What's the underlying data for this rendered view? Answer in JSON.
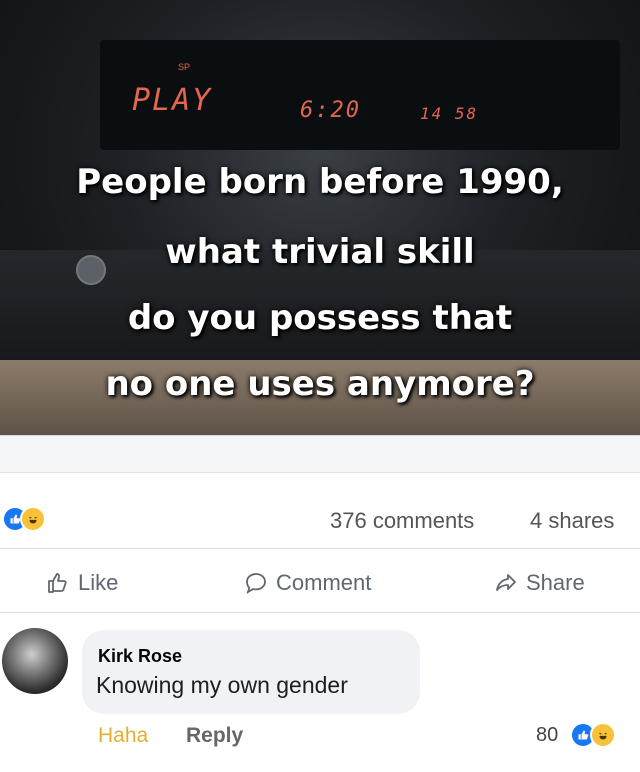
{
  "image": {
    "vcr_play": "PLAY",
    "vcr_sp": "SP",
    "vcr_time": "6:20",
    "vcr_counter": "14 58",
    "overlay_lines": [
      "People born before 1990,",
      "what trivial skill",
      "do you possess that",
      "no one uses anymore?"
    ]
  },
  "post_stats": {
    "reactions": [
      "like",
      "haha"
    ],
    "comments": "376 comments",
    "shares": "4 shares"
  },
  "actions": {
    "like": "Like",
    "comment": "Comment",
    "share": "Share"
  },
  "comment": {
    "author": "Kirk Rose",
    "text": "Knowing my own gender",
    "haha_label": "Haha",
    "reply_label": "Reply",
    "reaction_count": "80"
  },
  "colors": {
    "facebook_blue": "#1877f2",
    "haha_yellow": "#f7c23a",
    "haha_text": "#e2b030",
    "muted_text": "#606770"
  }
}
